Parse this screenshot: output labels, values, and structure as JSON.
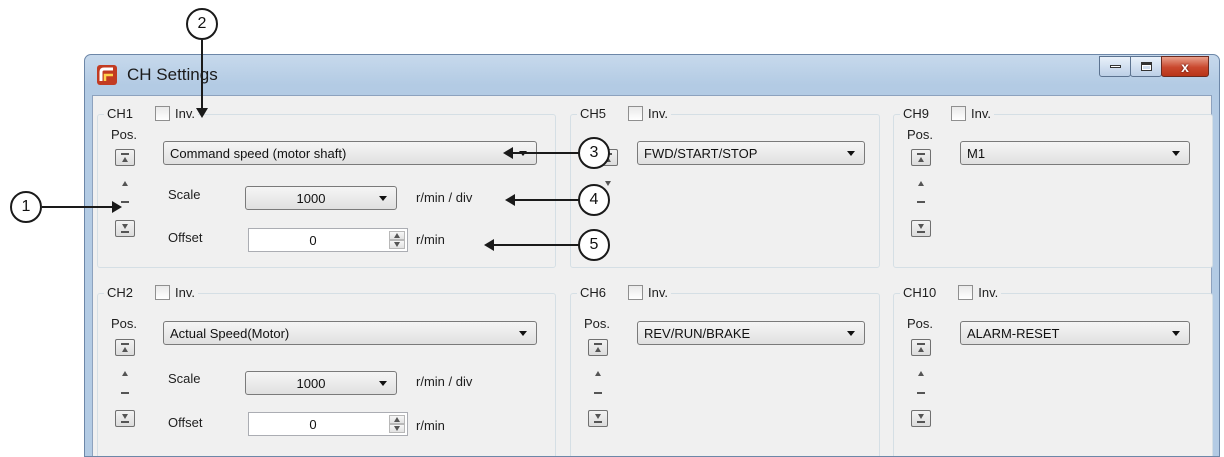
{
  "window": {
    "title": "CH Settings",
    "controls": {
      "minimize_icon": "minimize-icon",
      "maximize_icon": "maximize-icon",
      "close_label": "x"
    }
  },
  "channels": {
    "ch1": {
      "name": "CH1",
      "inv": "Inv.",
      "pos": "Pos.",
      "signal": "Command speed (motor shaft)",
      "scale_label": "Scale",
      "scale": "1000",
      "scale_unit": "r/min / div",
      "offset_label": "Offset",
      "offset": "0",
      "offset_unit": "r/min"
    },
    "ch2": {
      "name": "CH2",
      "inv": "Inv.",
      "pos": "Pos.",
      "signal": "Actual Speed(Motor)",
      "scale_label": "Scale",
      "scale": "1000",
      "scale_unit": "r/min / div",
      "offset_label": "Offset",
      "offset": "0",
      "offset_unit": "r/min"
    },
    "ch5": {
      "name": "CH5",
      "inv": "Inv.",
      "signal": "FWD/START/STOP"
    },
    "ch6": {
      "name": "CH6",
      "inv": "Inv.",
      "pos": "Pos.",
      "signal": "REV/RUN/BRAKE"
    },
    "ch9": {
      "name": "CH9",
      "inv": "Inv.",
      "pos": "Pos.",
      "signal": "M1"
    },
    "ch10": {
      "name": "CH10",
      "inv": "Inv.",
      "pos": "Pos.",
      "signal": "ALARM-RESET"
    }
  },
  "callouts": [
    "1",
    "2",
    "3",
    "4",
    "5"
  ]
}
